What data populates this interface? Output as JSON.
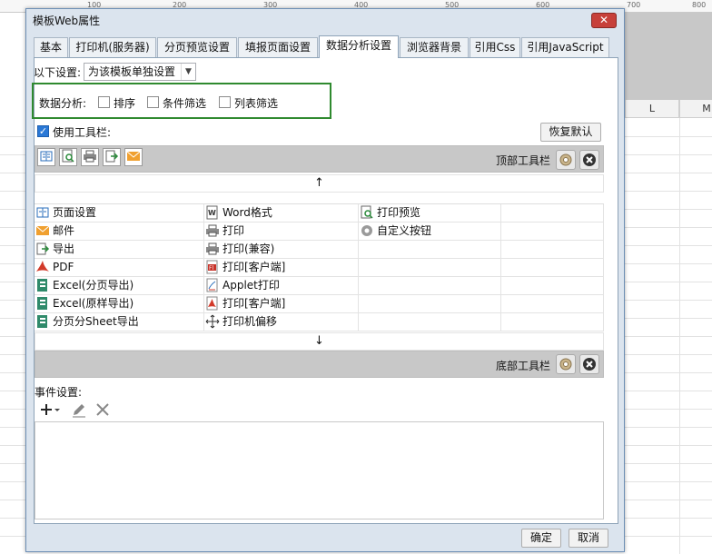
{
  "background": {
    "ruler_numbers": [
      "100",
      "200",
      "300",
      "400",
      "500",
      "600",
      "700",
      "800"
    ],
    "col_headers": [
      "L",
      "M"
    ]
  },
  "dialog": {
    "title": "模板Web属性",
    "close_label": "✕",
    "tabs": [
      "基本",
      "打印机(服务器)",
      "分页预览设置",
      "填报页面设置",
      "数据分析设置",
      "浏览器背景",
      "引用Css",
      "引用JavaScript"
    ],
    "active_tab": "数据分析设置",
    "settings_label": "以下设置:",
    "settings_value": "为该模板单独设置",
    "analysis_label": "数据分析:",
    "analysis_options": [
      {
        "label": "排序",
        "checked": false
      },
      {
        "label": "条件筛选",
        "checked": false
      },
      {
        "label": "列表筛选",
        "checked": false
      }
    ],
    "use_toolbar_label": "使用工具栏:",
    "use_toolbar_checked": true,
    "restore_default_label": "恢复默认",
    "top_toolbar_label": "顶部工具栏",
    "bottom_toolbar_label": "底部工具栏",
    "up_arrow": "↑",
    "down_arrow": "↓",
    "buttons_col1": [
      "页面设置",
      "邮件",
      "导出",
      "PDF",
      "Excel(分页导出)",
      "Excel(原样导出)",
      "分页分Sheet导出"
    ],
    "buttons_col2": [
      "Word格式",
      "打印",
      "打印(兼容)",
      "打印[客户端]",
      "Applet打印",
      "打印[客户端]",
      "打印机偏移"
    ],
    "buttons_col3": [
      "打印预览",
      "自定义按钮"
    ],
    "event_label": "事件设置:",
    "ok_label": "确定",
    "cancel_label": "取消"
  },
  "colors": {
    "highlight_border": "#2f8a2f",
    "toolbar_strip": "#c8c8c8",
    "checkbox_checked": "#2a78d6"
  }
}
